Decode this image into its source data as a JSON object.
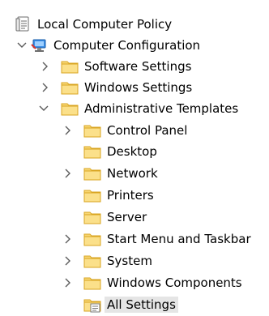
{
  "tree": {
    "root": {
      "label": "Local Computer Policy",
      "icon": "policy-document-icon"
    },
    "computer_configuration": {
      "label": "Computer Configuration",
      "icon": "computer-icon",
      "expanded": true
    },
    "software_settings": {
      "label": "Software Settings",
      "icon": "folder-icon",
      "expanded": false
    },
    "windows_settings": {
      "label": "Windows Settings",
      "icon": "folder-icon",
      "expanded": false
    },
    "administrative_templates": {
      "label": "Administrative Templates",
      "icon": "folder-icon",
      "expanded": true
    },
    "control_panel": {
      "label": "Control Panel",
      "icon": "folder-icon",
      "expanded": false
    },
    "desktop": {
      "label": "Desktop",
      "icon": "folder-icon"
    },
    "network": {
      "label": "Network",
      "icon": "folder-icon",
      "expanded": false
    },
    "printers": {
      "label": "Printers",
      "icon": "folder-icon"
    },
    "server": {
      "label": "Server",
      "icon": "folder-icon"
    },
    "start_menu_taskbar": {
      "label": "Start Menu and Taskbar",
      "icon": "folder-icon",
      "expanded": false
    },
    "system": {
      "label": "System",
      "icon": "folder-icon",
      "expanded": false
    },
    "windows_components": {
      "label": "Windows Components",
      "icon": "folder-icon",
      "expanded": false
    },
    "all_settings": {
      "label": "All Settings",
      "icon": "all-settings-folder-icon",
      "selected": true
    }
  },
  "colors": {
    "folder_fill": "#f8d775",
    "folder_edge": "#d9a521",
    "chevron": "#5a5a5a",
    "selection": "#e5e5e5"
  }
}
